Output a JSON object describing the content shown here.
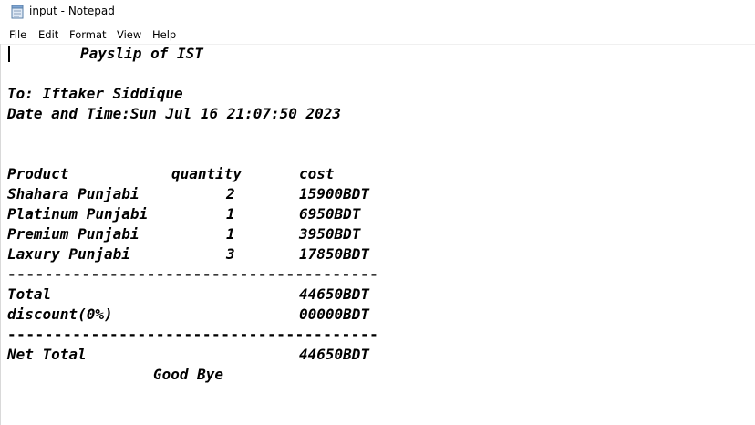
{
  "window": {
    "title": "input - Notepad",
    "icon": "notepad-icon"
  },
  "menu": {
    "items": [
      "File",
      "Edit",
      "Format",
      "View",
      "Help"
    ]
  },
  "document": {
    "heading": "Payslip of IST",
    "to": "To: Iftaker Siddique",
    "datetime": "Date and Time:Sun Jul 16 21:07:50 2023",
    "columns": {
      "product": "Product",
      "quantity": "quantity",
      "cost": "cost"
    },
    "rows": [
      {
        "product": "Shahara Punjabi",
        "quantity": "2",
        "cost": "15900BDT"
      },
      {
        "product": "Platinum Punjabi",
        "quantity": "1",
        "cost": "6950BDT"
      },
      {
        "product": "Premium Punjabi",
        "quantity": "1",
        "cost": "3950BDT"
      },
      {
        "product": "Laxury Punjabi",
        "quantity": "3",
        "cost": "17850BDT"
      }
    ],
    "separator": "----------------------------------------",
    "total_label": "Total",
    "total_value": "44650BDT",
    "discount_label": "discount(0%)",
    "discount_value": "00000BDT",
    "net_total_label": "Net Total",
    "net_total_value": "44650BDT",
    "farewell": "Good Bye"
  }
}
